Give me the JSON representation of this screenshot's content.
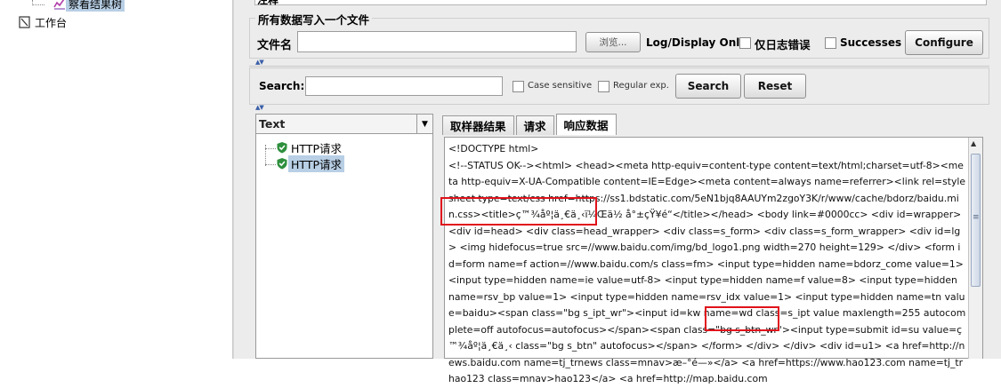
{
  "tree": {
    "view_results_tree": "察看结果树",
    "workbench": "工作台"
  },
  "file_section": {
    "partial_header": "注释",
    "legend": "所有数据写入一个文件",
    "filename_label": "文件名",
    "filename_value": "",
    "browse_label": "浏览...",
    "log_display_label": "Log/Display Only:",
    "errors_only_label": "仅日志错误",
    "successes_label": "Successes",
    "configure_label": "Configure"
  },
  "search_bar": {
    "label": "Search:",
    "value": "",
    "case_sensitive_label": "Case sensitive",
    "regular_exp_label": "Regular exp.",
    "search_button": "Search",
    "reset_button": "Reset"
  },
  "render_panel": {
    "combo_value": "Text",
    "items": [
      "HTTP请求",
      "HTTP请求"
    ]
  },
  "result_tabs": [
    "取样器结果",
    "请求",
    "响应数据"
  ],
  "response": {
    "lines": [
      "<!DOCTYPE html>",
      "<!--STATUS OK--><html> <head><meta http-equiv=content-type content=text/html;charset=utf-8><meta http-equiv=X-UA-Compatible content=IE=Edge><meta content=always name=referrer><link rel=stylesheet type=text/css href=https://ss1.bdstatic.com/5eN1bjq8AAUYm2zgoY3K/r/www/cache/bdorz/baidu.min.css><title>ç™¾åº¦ä¸€ä¸‹ï¼Œä½ å°±çŸ¥é“</title></head> <body link=#0000cc> <div id=wrapper> <div id=head> <div class=head_wrapper> <div class=s_form> <div class=s_form_wrapper> <div id=lg> <img hidefocus=true src=//www.baidu.com/img/bd_logo1.png width=270 height=129> </div> <form id=form name=f action=//www.baidu.com/s class=fm> <input type=hidden name=bdorz_come value=1> <input type=hidden name=ie value=utf-8> <input type=hidden name=f value=8> <input type=hidden name=rsv_bp value=1> <input type=hidden name=rsv_idx value=1> <input type=hidden name=tn value=baidu><span class=\"bg s_ipt_wr\"><input id=kw name=wd class=s_ipt value maxlength=255 autocomplete=off autofocus=autofocus></span><span class=\"bg s_btn_wr\"><input type=submit id=su value=ç™¾åº¦ä¸€ä¸‹ class=\"bg s_btn\" autofocus></span> </form> </div> </div> <div id=u1> <a href=http://news.baidu.com name=tj_trnews class=mnav>æ–°é—»</a> <a href=https://www.hao123.com name=tj_trhao123 class=mnav>hao123</a> <a href=http://map.baidu.com"
    ]
  }
}
